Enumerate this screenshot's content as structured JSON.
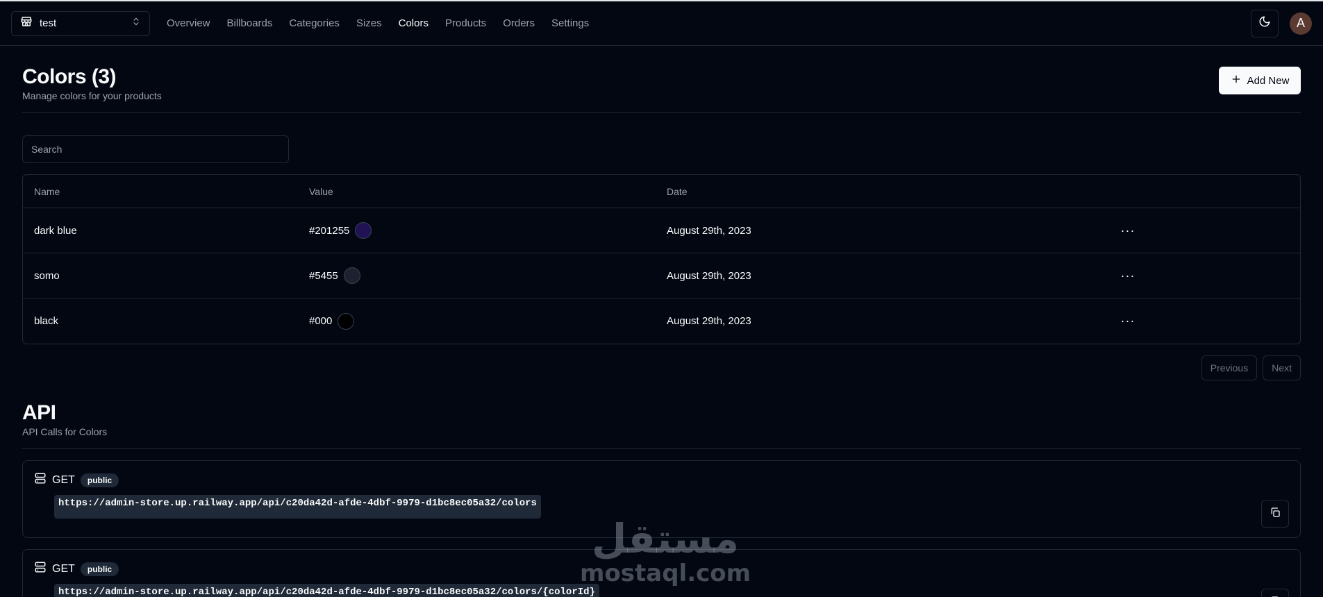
{
  "store": {
    "name": "test",
    "icon": "store-icon"
  },
  "nav": [
    {
      "label": "Overview",
      "active": false
    },
    {
      "label": "Billboards",
      "active": false
    },
    {
      "label": "Categories",
      "active": false
    },
    {
      "label": "Sizes",
      "active": false
    },
    {
      "label": "Colors",
      "active": true
    },
    {
      "label": "Products",
      "active": false
    },
    {
      "label": "Orders",
      "active": false
    },
    {
      "label": "Settings",
      "active": false
    }
  ],
  "user": {
    "initial": "A"
  },
  "header": {
    "title": "Colors (3)",
    "subtitle": "Manage colors for your products",
    "add_label": "Add New"
  },
  "search": {
    "placeholder": "Search"
  },
  "table": {
    "columns": [
      "Name",
      "Value",
      "Date"
    ],
    "rows": [
      {
        "name": "dark blue",
        "value": "#201255",
        "swatch": "#201255",
        "date": "August 29th, 2023"
      },
      {
        "name": "somo",
        "value": "#5455",
        "swatch": "#1f2130",
        "date": "August 29th, 2023"
      },
      {
        "name": "black",
        "value": "#000",
        "swatch": "#000000",
        "date": "August 29th, 2023"
      }
    ]
  },
  "pagination": {
    "previous": "Previous",
    "next": "Next"
  },
  "api": {
    "title": "API",
    "subtitle": "API Calls for Colors",
    "calls": [
      {
        "method": "GET",
        "badge": "public",
        "url": "https://admin-store.up.railway.app/api/c20da42d-afde-4dbf-9979-d1bc8ec05a32/colors"
      },
      {
        "method": "GET",
        "badge": "public",
        "url": "https://admin-store.up.railway.app/api/c20da42d-afde-4dbf-9979-d1bc8ec05a32/colors/{colorId}"
      }
    ]
  },
  "watermark": {
    "arabic": "مستقل",
    "latin": "mostaql.com"
  },
  "colors": {
    "background": "#030712",
    "border": "#1f2937",
    "muted": "#9ca3af",
    "foreground": "#f9fafb"
  }
}
